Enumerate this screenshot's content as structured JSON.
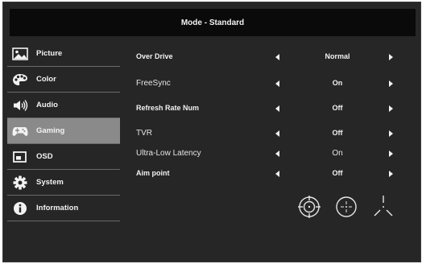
{
  "header": {
    "title": "Mode - Standard"
  },
  "sidebar": {
    "items": [
      {
        "label": "Picture",
        "icon": "picture-icon"
      },
      {
        "label": "Color",
        "icon": "palette-icon"
      },
      {
        "label": "Audio",
        "icon": "speaker-icon"
      },
      {
        "label": "Gaming",
        "icon": "gamepad-icon",
        "active": true
      },
      {
        "label": "OSD",
        "icon": "osd-icon"
      },
      {
        "label": "System",
        "icon": "gear-icon"
      },
      {
        "label": "Information",
        "icon": "info-icon"
      }
    ]
  },
  "settings": [
    {
      "label": "Over  Drive",
      "value": "Normal"
    },
    {
      "label": "FreeSync",
      "value": "On"
    },
    {
      "label": "Refresh Rate Num",
      "value": "Off"
    },
    {
      "label": "TVR",
      "value": "Off"
    },
    {
      "label": "Ultra-Low Latency",
      "value": "On"
    },
    {
      "label": "Aim point",
      "value": "Off"
    }
  ],
  "crosshairs": [
    "crosshair-circle-icon",
    "crosshair-dotted-icon",
    "crosshair-y-icon"
  ],
  "colors": {
    "panel": "#262626",
    "header": "#0a0a0a",
    "active": "#8a8a8a",
    "text": "#f2f2f2"
  }
}
